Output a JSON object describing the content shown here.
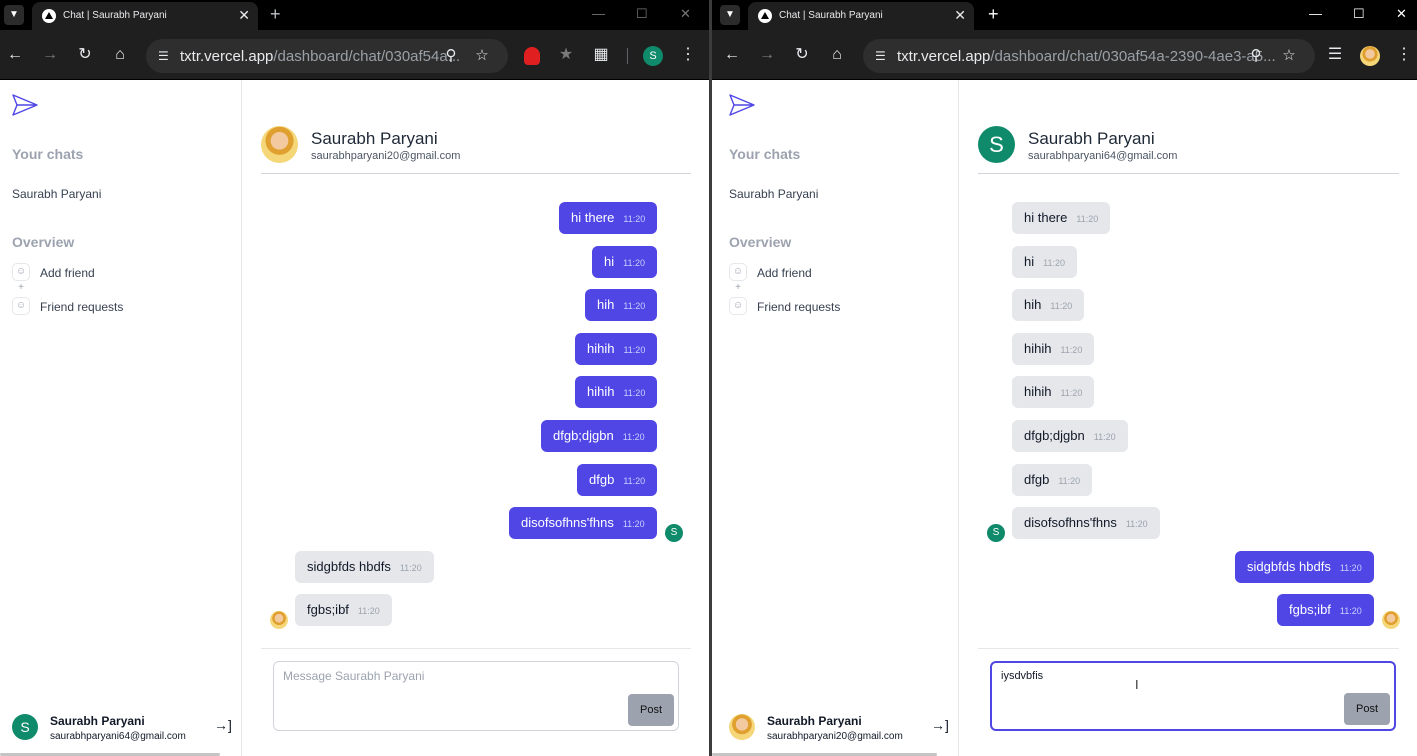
{
  "left": {
    "tab_title": "Chat | Saurabh Paryani",
    "url_host": "txtr.vercel.app",
    "url_path": "/dashboard/chat/030af54a...",
    "profile_initial": "S",
    "sidebar": {
      "your_chats": "Your chats",
      "chat_item": "Saurabh Paryani",
      "overview": "Overview",
      "add_friend": "Add friend",
      "friend_requests": "Friend requests",
      "user_name": "Saurabh Paryani",
      "user_email": "saurabhparyani64@gmail.com",
      "user_initial": "S"
    },
    "header": {
      "name": "Saurabh Paryani",
      "email": "saurabhparyani20@gmail.com"
    },
    "messages": [
      {
        "text": "hi there",
        "time": "11:20",
        "mine": true
      },
      {
        "text": "hi",
        "time": "11:20",
        "mine": true
      },
      {
        "text": "hih",
        "time": "11:20",
        "mine": true
      },
      {
        "text": "hihih",
        "time": "11:20",
        "mine": true
      },
      {
        "text": "hihih",
        "time": "11:20",
        "mine": true
      },
      {
        "text": "dfgb;djgbn",
        "time": "11:20",
        "mine": true
      },
      {
        "text": "dfgb",
        "time": "11:20",
        "mine": true
      },
      {
        "text": "disofsofhns'fhns",
        "time": "11:20",
        "mine": true
      },
      {
        "text": "sidgbfds hbdfs",
        "time": "11:20",
        "mine": false
      },
      {
        "text": "fgbs;ibf",
        "time": "11:20",
        "mine": false
      }
    ],
    "composer": {
      "placeholder": "Message Saurabh Paryani",
      "value": "",
      "post_label": "Post"
    }
  },
  "right": {
    "tab_title": "Chat | Saurabh Paryani",
    "url_host": "txtr.vercel.app",
    "url_path": "/dashboard/chat/030af54a-2390-4ae3-a5...",
    "sidebar": {
      "your_chats": "Your chats",
      "chat_item": "Saurabh Paryani",
      "overview": "Overview",
      "add_friend": "Add friend",
      "friend_requests": "Friend requests",
      "user_name": "Saurabh Paryani",
      "user_email": "saurabhparyani20@gmail.com"
    },
    "header": {
      "name": "Saurabh Paryani",
      "email": "saurabhparyani64@gmail.com",
      "initial": "S"
    },
    "messages": [
      {
        "text": "hi there",
        "time": "11:20",
        "mine": false
      },
      {
        "text": "hi",
        "time": "11:20",
        "mine": false
      },
      {
        "text": "hih",
        "time": "11:20",
        "mine": false
      },
      {
        "text": "hihih",
        "time": "11:20",
        "mine": false
      },
      {
        "text": "hihih",
        "time": "11:20",
        "mine": false
      },
      {
        "text": "dfgb;djgbn",
        "time": "11:20",
        "mine": false
      },
      {
        "text": "dfgb",
        "time": "11:20",
        "mine": false
      },
      {
        "text": "disofsofhns'fhns",
        "time": "11:20",
        "mine": false
      },
      {
        "text": "sidgbfds hbdfs",
        "time": "11:20",
        "mine": true
      },
      {
        "text": "fgbs;ibf",
        "time": "11:20",
        "mine": true
      }
    ],
    "other_initial": "S",
    "composer": {
      "value": "iysdvbfis",
      "post_label": "Post"
    }
  },
  "colors": {
    "accent": "#4f46e5",
    "avatar_green": "#0f8a6b",
    "bubble_grey": "#e5e7eb"
  }
}
